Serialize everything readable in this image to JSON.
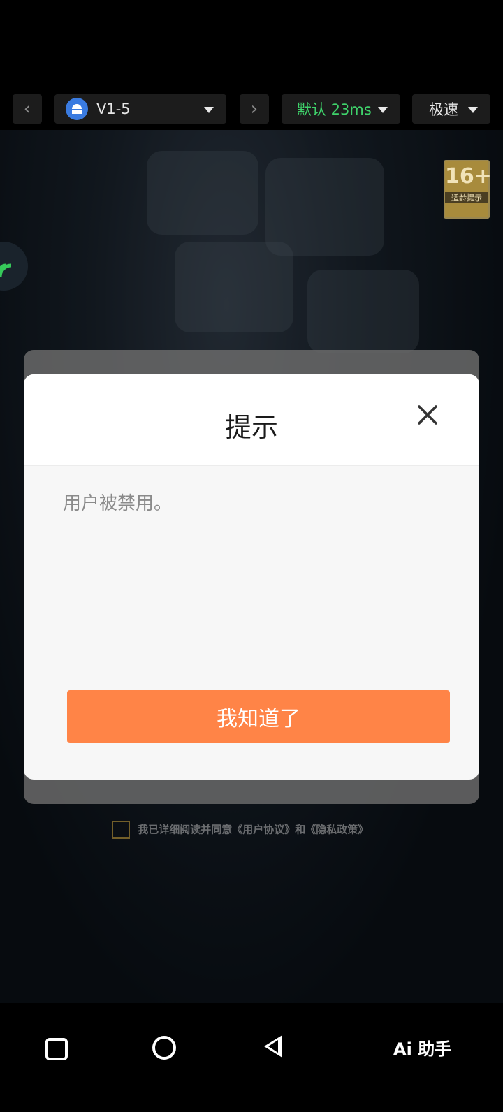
{
  "topbar": {
    "back_icon": "chevron-left-icon",
    "device_name": "V1-5",
    "forward_icon": "chevron-right-icon",
    "line_mode": "默认 23ms",
    "line_color": "#3fd36b",
    "speed_mode": "极速"
  },
  "game": {
    "age_rating": "16+",
    "age_label": "适龄提示",
    "consent_text": "我已详细阅读并同意《用户协议》和《隐私政策》"
  },
  "dialog": {
    "title": "提示",
    "message": "用户被禁用。",
    "confirm_label": "我知道了",
    "accent": "#ff8447"
  },
  "navbar": {
    "ai_label": "Ai 助手"
  }
}
